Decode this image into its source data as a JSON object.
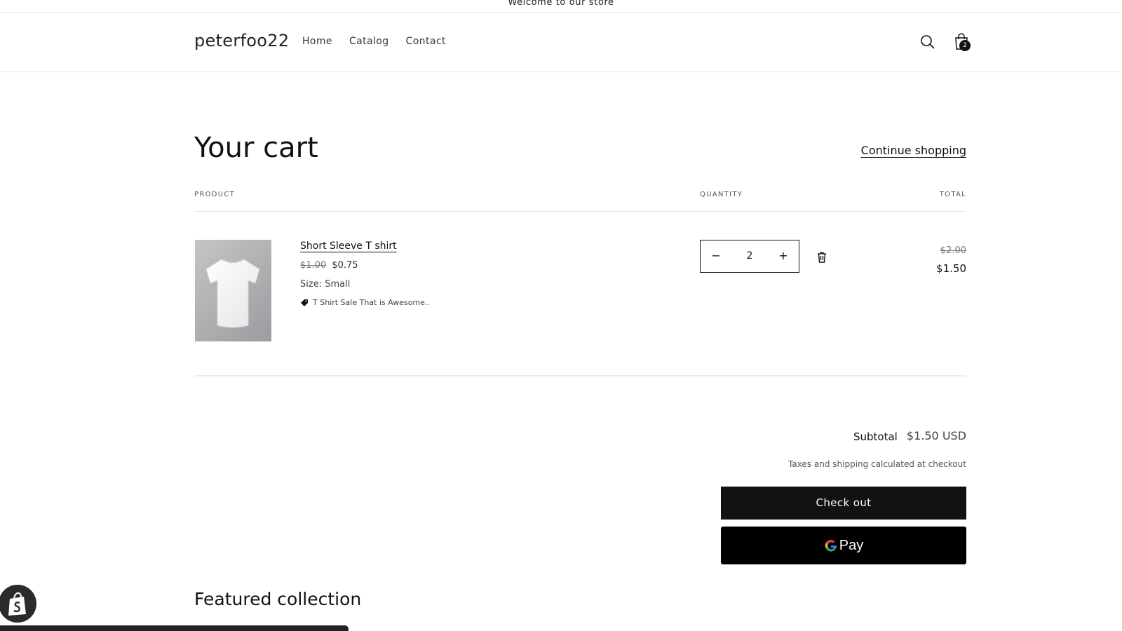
{
  "announcement": "Welcome to our store",
  "header": {
    "logo": "peterfoo22",
    "nav": [
      "Home",
      "Catalog",
      "Contact"
    ],
    "cart_count": "2"
  },
  "cart": {
    "title": "Your cart",
    "continue_label": "Continue shopping",
    "columns": {
      "product": "PRODUCT",
      "quantity": "QUANTITY",
      "total": "TOTAL"
    },
    "item": {
      "name": "Short Sleeve T shirt",
      "compare_price": "$1.00",
      "price": "$0.75",
      "option": "Size: Small",
      "discount": "T Shirt Sale That is Awesome..",
      "quantity": "2",
      "total_compare": "$2.00",
      "total": "$1.50"
    },
    "subtotal_label": "Subtotal",
    "subtotal_value": "$1.50 USD",
    "tax_note": "Taxes and shipping calculated at checkout",
    "checkout_label": "Check out",
    "gpay_label": "Pay"
  },
  "featured_title": "Featured collection",
  "colors": {
    "primary": "#121212",
    "border": "#e6e6e6",
    "muted": "#777777"
  }
}
